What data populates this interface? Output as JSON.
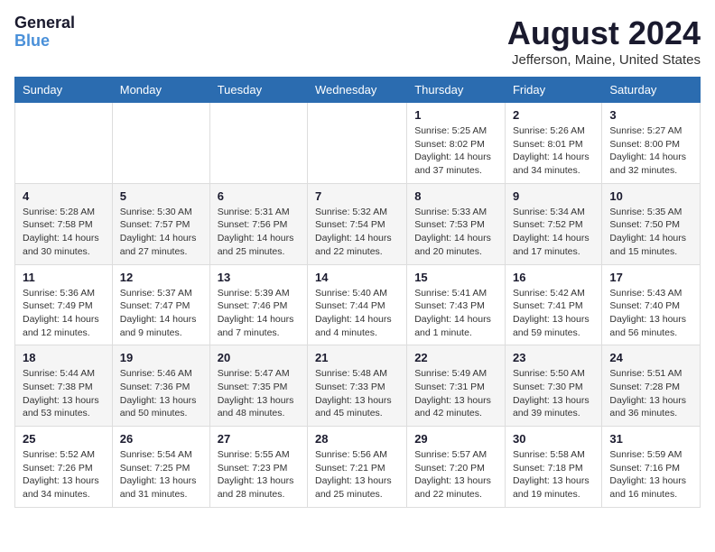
{
  "logo": {
    "line1": "General",
    "line2": "Blue"
  },
  "title": "August 2024",
  "location": "Jefferson, Maine, United States",
  "days_header": [
    "Sunday",
    "Monday",
    "Tuesday",
    "Wednesday",
    "Thursday",
    "Friday",
    "Saturday"
  ],
  "weeks": [
    [
      {
        "day": "",
        "sunrise": "",
        "sunset": "",
        "daylight": ""
      },
      {
        "day": "",
        "sunrise": "",
        "sunset": "",
        "daylight": ""
      },
      {
        "day": "",
        "sunrise": "",
        "sunset": "",
        "daylight": ""
      },
      {
        "day": "",
        "sunrise": "",
        "sunset": "",
        "daylight": ""
      },
      {
        "day": "1",
        "sunrise": "Sunrise: 5:25 AM",
        "sunset": "Sunset: 8:02 PM",
        "daylight": "Daylight: 14 hours and 37 minutes."
      },
      {
        "day": "2",
        "sunrise": "Sunrise: 5:26 AM",
        "sunset": "Sunset: 8:01 PM",
        "daylight": "Daylight: 14 hours and 34 minutes."
      },
      {
        "day": "3",
        "sunrise": "Sunrise: 5:27 AM",
        "sunset": "Sunset: 8:00 PM",
        "daylight": "Daylight: 14 hours and 32 minutes."
      }
    ],
    [
      {
        "day": "4",
        "sunrise": "Sunrise: 5:28 AM",
        "sunset": "Sunset: 7:58 PM",
        "daylight": "Daylight: 14 hours and 30 minutes."
      },
      {
        "day": "5",
        "sunrise": "Sunrise: 5:30 AM",
        "sunset": "Sunset: 7:57 PM",
        "daylight": "Daylight: 14 hours and 27 minutes."
      },
      {
        "day": "6",
        "sunrise": "Sunrise: 5:31 AM",
        "sunset": "Sunset: 7:56 PM",
        "daylight": "Daylight: 14 hours and 25 minutes."
      },
      {
        "day": "7",
        "sunrise": "Sunrise: 5:32 AM",
        "sunset": "Sunset: 7:54 PM",
        "daylight": "Daylight: 14 hours and 22 minutes."
      },
      {
        "day": "8",
        "sunrise": "Sunrise: 5:33 AM",
        "sunset": "Sunset: 7:53 PM",
        "daylight": "Daylight: 14 hours and 20 minutes."
      },
      {
        "day": "9",
        "sunrise": "Sunrise: 5:34 AM",
        "sunset": "Sunset: 7:52 PM",
        "daylight": "Daylight: 14 hours and 17 minutes."
      },
      {
        "day": "10",
        "sunrise": "Sunrise: 5:35 AM",
        "sunset": "Sunset: 7:50 PM",
        "daylight": "Daylight: 14 hours and 15 minutes."
      }
    ],
    [
      {
        "day": "11",
        "sunrise": "Sunrise: 5:36 AM",
        "sunset": "Sunset: 7:49 PM",
        "daylight": "Daylight: 14 hours and 12 minutes."
      },
      {
        "day": "12",
        "sunrise": "Sunrise: 5:37 AM",
        "sunset": "Sunset: 7:47 PM",
        "daylight": "Daylight: 14 hours and 9 minutes."
      },
      {
        "day": "13",
        "sunrise": "Sunrise: 5:39 AM",
        "sunset": "Sunset: 7:46 PM",
        "daylight": "Daylight: 14 hours and 7 minutes."
      },
      {
        "day": "14",
        "sunrise": "Sunrise: 5:40 AM",
        "sunset": "Sunset: 7:44 PM",
        "daylight": "Daylight: 14 hours and 4 minutes."
      },
      {
        "day": "15",
        "sunrise": "Sunrise: 5:41 AM",
        "sunset": "Sunset: 7:43 PM",
        "daylight": "Daylight: 14 hours and 1 minute."
      },
      {
        "day": "16",
        "sunrise": "Sunrise: 5:42 AM",
        "sunset": "Sunset: 7:41 PM",
        "daylight": "Daylight: 13 hours and 59 minutes."
      },
      {
        "day": "17",
        "sunrise": "Sunrise: 5:43 AM",
        "sunset": "Sunset: 7:40 PM",
        "daylight": "Daylight: 13 hours and 56 minutes."
      }
    ],
    [
      {
        "day": "18",
        "sunrise": "Sunrise: 5:44 AM",
        "sunset": "Sunset: 7:38 PM",
        "daylight": "Daylight: 13 hours and 53 minutes."
      },
      {
        "day": "19",
        "sunrise": "Sunrise: 5:46 AM",
        "sunset": "Sunset: 7:36 PM",
        "daylight": "Daylight: 13 hours and 50 minutes."
      },
      {
        "day": "20",
        "sunrise": "Sunrise: 5:47 AM",
        "sunset": "Sunset: 7:35 PM",
        "daylight": "Daylight: 13 hours and 48 minutes."
      },
      {
        "day": "21",
        "sunrise": "Sunrise: 5:48 AM",
        "sunset": "Sunset: 7:33 PM",
        "daylight": "Daylight: 13 hours and 45 minutes."
      },
      {
        "day": "22",
        "sunrise": "Sunrise: 5:49 AM",
        "sunset": "Sunset: 7:31 PM",
        "daylight": "Daylight: 13 hours and 42 minutes."
      },
      {
        "day": "23",
        "sunrise": "Sunrise: 5:50 AM",
        "sunset": "Sunset: 7:30 PM",
        "daylight": "Daylight: 13 hours and 39 minutes."
      },
      {
        "day": "24",
        "sunrise": "Sunrise: 5:51 AM",
        "sunset": "Sunset: 7:28 PM",
        "daylight": "Daylight: 13 hours and 36 minutes."
      }
    ],
    [
      {
        "day": "25",
        "sunrise": "Sunrise: 5:52 AM",
        "sunset": "Sunset: 7:26 PM",
        "daylight": "Daylight: 13 hours and 34 minutes."
      },
      {
        "day": "26",
        "sunrise": "Sunrise: 5:54 AM",
        "sunset": "Sunset: 7:25 PM",
        "daylight": "Daylight: 13 hours and 31 minutes."
      },
      {
        "day": "27",
        "sunrise": "Sunrise: 5:55 AM",
        "sunset": "Sunset: 7:23 PM",
        "daylight": "Daylight: 13 hours and 28 minutes."
      },
      {
        "day": "28",
        "sunrise": "Sunrise: 5:56 AM",
        "sunset": "Sunset: 7:21 PM",
        "daylight": "Daylight: 13 hours and 25 minutes."
      },
      {
        "day": "29",
        "sunrise": "Sunrise: 5:57 AM",
        "sunset": "Sunset: 7:20 PM",
        "daylight": "Daylight: 13 hours and 22 minutes."
      },
      {
        "day": "30",
        "sunrise": "Sunrise: 5:58 AM",
        "sunset": "Sunset: 7:18 PM",
        "daylight": "Daylight: 13 hours and 19 minutes."
      },
      {
        "day": "31",
        "sunrise": "Sunrise: 5:59 AM",
        "sunset": "Sunset: 7:16 PM",
        "daylight": "Daylight: 13 hours and 16 minutes."
      }
    ]
  ]
}
